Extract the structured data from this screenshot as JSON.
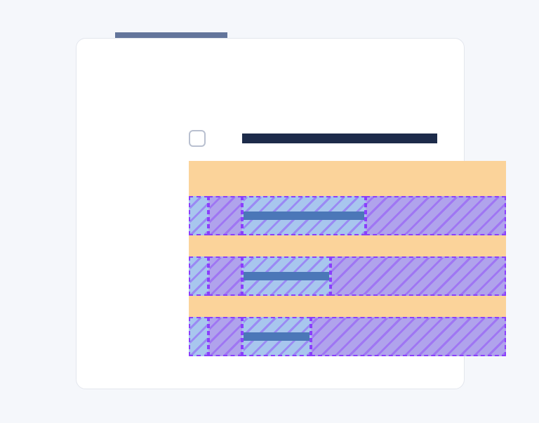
{
  "tab": {
    "label": "••••••••••••••••••••••••••••"
  },
  "header": {
    "title": ""
  },
  "rows": [
    {
      "progress_width": 176,
      "remainder_width": 200
    },
    {
      "progress_width": 126,
      "remainder_width": 250
    },
    {
      "progress_width": 98,
      "remainder_width": 278
    }
  ],
  "colors": {
    "page_bg": "#f5f7fb",
    "card_bg": "#ffffff",
    "card_border": "#e3e6ed",
    "tab_bg": "#63759b",
    "title_bar": "#1d2b4a",
    "checkbox_border": "#b9c0d0",
    "spacer": "#fbd39a",
    "cell_light": "#a8c6ee",
    "cell_purple": "#b0a3ec",
    "dash": "#8a3ffc",
    "inner_bar": "#4b77b8"
  }
}
